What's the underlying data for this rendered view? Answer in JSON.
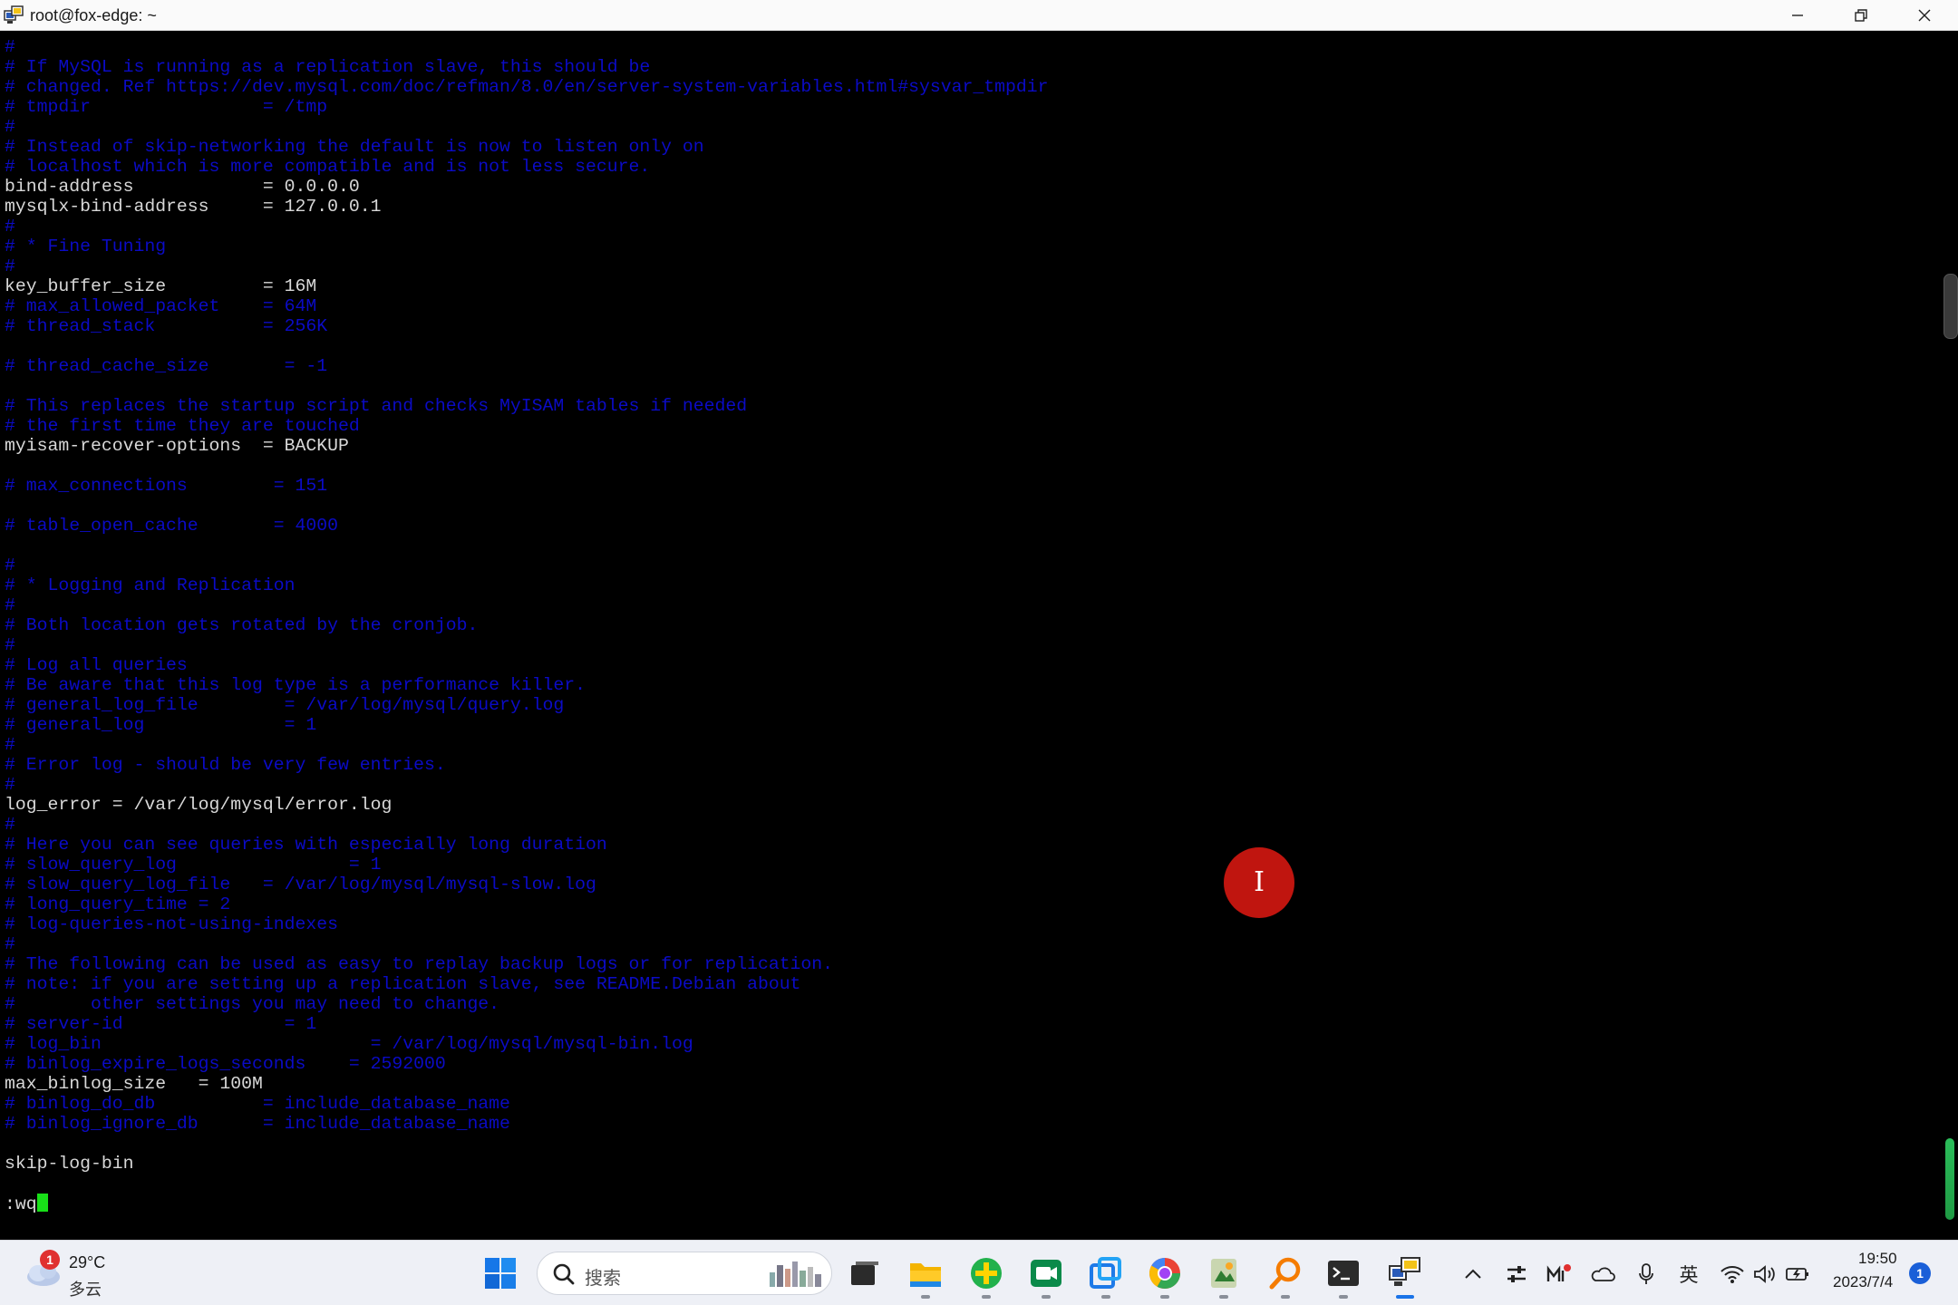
{
  "window": {
    "title": "root@fox-edge: ~",
    "controls": {
      "minimize_icon": "minimize-icon",
      "restore_icon": "restore-icon",
      "close_icon": "close-icon"
    }
  },
  "terminal": {
    "text_color": "#d8d8d8",
    "comment_color": "#0b0bc6",
    "cursor_color": "#18e018",
    "lines": [
      {
        "type": "comment",
        "text": "#"
      },
      {
        "type": "comment",
        "text": "# If MySQL is running as a replication slave, this should be"
      },
      {
        "type": "comment",
        "text": "# changed. Ref https://dev.mysql.com/doc/refman/8.0/en/server-system-variables.html#sysvar_tmpdir"
      },
      {
        "type": "comment",
        "text": "# tmpdir                = /tmp"
      },
      {
        "type": "comment",
        "text": "#"
      },
      {
        "type": "comment",
        "text": "# Instead of skip-networking the default is now to listen only on"
      },
      {
        "type": "comment",
        "text": "# localhost which is more compatible and is not less secure."
      },
      {
        "type": "setting",
        "text": "bind-address            = 0.0.0.0"
      },
      {
        "type": "setting",
        "text": "mysqlx-bind-address     = 127.0.0.1"
      },
      {
        "type": "comment",
        "text": "#"
      },
      {
        "type": "comment",
        "text": "# * Fine Tuning"
      },
      {
        "type": "comment",
        "text": "#"
      },
      {
        "type": "setting",
        "text": "key_buffer_size         = 16M"
      },
      {
        "type": "comment",
        "text": "# max_allowed_packet    = 64M"
      },
      {
        "type": "comment",
        "text": "# thread_stack          = 256K"
      },
      {
        "type": "blank",
        "text": ""
      },
      {
        "type": "comment",
        "text": "# thread_cache_size       = -1"
      },
      {
        "type": "blank",
        "text": ""
      },
      {
        "type": "comment",
        "text": "# This replaces the startup script and checks MyISAM tables if needed"
      },
      {
        "type": "comment",
        "text": "# the first time they are touched"
      },
      {
        "type": "setting",
        "text": "myisam-recover-options  = BACKUP"
      },
      {
        "type": "blank",
        "text": ""
      },
      {
        "type": "comment",
        "text": "# max_connections        = 151"
      },
      {
        "type": "blank",
        "text": ""
      },
      {
        "type": "comment",
        "text": "# table_open_cache       = 4000"
      },
      {
        "type": "blank",
        "text": ""
      },
      {
        "type": "comment",
        "text": "#"
      },
      {
        "type": "comment",
        "text": "# * Logging and Replication"
      },
      {
        "type": "comment",
        "text": "#"
      },
      {
        "type": "comment",
        "text": "# Both location gets rotated by the cronjob."
      },
      {
        "type": "comment",
        "text": "#"
      },
      {
        "type": "comment",
        "text": "# Log all queries"
      },
      {
        "type": "comment",
        "text": "# Be aware that this log type is a performance killer."
      },
      {
        "type": "comment",
        "text": "# general_log_file        = /var/log/mysql/query.log"
      },
      {
        "type": "comment",
        "text": "# general_log             = 1"
      },
      {
        "type": "comment",
        "text": "#"
      },
      {
        "type": "comment",
        "text": "# Error log - should be very few entries."
      },
      {
        "type": "comment",
        "text": "#"
      },
      {
        "type": "setting",
        "text": "log_error = /var/log/mysql/error.log"
      },
      {
        "type": "comment",
        "text": "#"
      },
      {
        "type": "comment",
        "text": "# Here you can see queries with especially long duration"
      },
      {
        "type": "comment",
        "text": "# slow_query_log                = 1"
      },
      {
        "type": "comment",
        "text": "# slow_query_log_file   = /var/log/mysql/mysql-slow.log"
      },
      {
        "type": "comment",
        "text": "# long_query_time = 2"
      },
      {
        "type": "comment",
        "text": "# log-queries-not-using-indexes"
      },
      {
        "type": "comment",
        "text": "#"
      },
      {
        "type": "comment",
        "text": "# The following can be used as easy to replay backup logs or for replication."
      },
      {
        "type": "comment",
        "text": "# note: if you are setting up a replication slave, see README.Debian about"
      },
      {
        "type": "comment",
        "text": "#       other settings you may need to change."
      },
      {
        "type": "comment",
        "text": "# server-id               = 1"
      },
      {
        "type": "comment",
        "text": "# log_bin                         = /var/log/mysql/mysql-bin.log"
      },
      {
        "type": "comment",
        "text": "# binlog_expire_logs_seconds    = 2592000"
      },
      {
        "type": "setting",
        "text": "max_binlog_size   = 100M"
      },
      {
        "type": "comment",
        "text": "# binlog_do_db          = include_database_name"
      },
      {
        "type": "comment",
        "text": "# binlog_ignore_db      = include_database_name"
      },
      {
        "type": "blank",
        "text": ""
      },
      {
        "type": "setting",
        "text": "skip-log-bin"
      },
      {
        "type": "blank",
        "text": ""
      }
    ],
    "command_line": ":wq"
  },
  "overlay": {
    "cursor_icon": "text-cursor-icon",
    "glyph": "I"
  },
  "taskbar": {
    "weather": {
      "temp": "29°C",
      "desc": "多云",
      "badge": "1",
      "icon": "cloud-weather-icon"
    },
    "search": {
      "placeholder": "搜索",
      "icon": "search-icon"
    },
    "apps": [
      {
        "name": "start-button",
        "icon": "windows-logo-icon"
      },
      {
        "name": "task-view-button",
        "icon": "task-view-icon"
      },
      {
        "name": "file-explorer-button",
        "icon": "folder-icon"
      },
      {
        "name": "app-green-plus-button",
        "icon": "green-plus-icon"
      },
      {
        "name": "app-meet-button",
        "icon": "video-meeting-icon"
      },
      {
        "name": "app-blue-squares-button",
        "icon": "blue-squares-icon"
      },
      {
        "name": "browser-button",
        "icon": "browser-icon"
      },
      {
        "name": "app-green-doc-button",
        "icon": "green-document-icon"
      },
      {
        "name": "app-search-tool-button",
        "icon": "magnifier-app-icon"
      },
      {
        "name": "terminal-button",
        "icon": "terminal-icon"
      },
      {
        "name": "ssh-client-button",
        "icon": "ssh-client-icon"
      }
    ],
    "tray": {
      "language": "英"
    },
    "clock": {
      "time": "19:50",
      "date": "2023/7/4"
    },
    "notifications": "1"
  }
}
